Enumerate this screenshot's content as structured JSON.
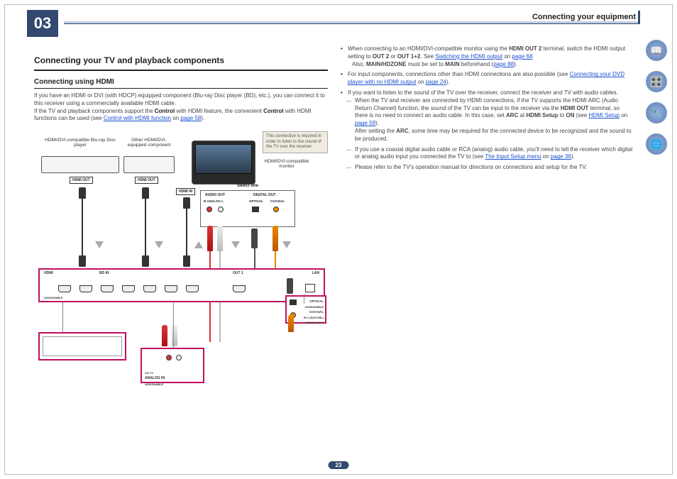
{
  "chapter": "03",
  "header": "Connecting your equipment",
  "page_number": "23",
  "left": {
    "h1": "Connecting your TV and playback components",
    "h2": "Connecting using HDMI",
    "p1a": "If you have an HDMI or DVI (with HDCP) equipped component (Blu-ray Disc player (BD), etc.), you can connect it to this receiver using a commercially available HDMI cable.",
    "p1b_a": "If the TV and playback components support the ",
    "p1b_b": "Control",
    "p1b_c": " with HDMI feature, the convenient ",
    "p1b_d": "Control",
    "p1b_e": " with HDMI functions can be used (see ",
    "link1": "Control with HDMI function",
    "p1b_f": " on ",
    "link1p": "page 58",
    "p1b_g": ")."
  },
  "right": {
    "b1a": "When connecting to an HDMI/DVI-compatible monitor using the ",
    "b1b": "HDMI OUT 2",
    "b1c": " terminal, switch the HDMI output setting to ",
    "b1d": "OUT 2",
    "b1e": " or ",
    "b1f": "OUT 1+2",
    "b1g": ". See ",
    "link_sw": "Switching the HDMI output",
    "b1h": " on ",
    "link_sw_p": "page 68",
    "b1i": ".",
    "b1j": "Also, ",
    "b1k": "MAIN/HDZONE",
    "b1l": " must be set to ",
    "b1m": "MAIN",
    "b1n": " beforehand (",
    "link_main_p": "page 88",
    "b1o": ").",
    "b2a": "For input components, connections other than HDMI connections are also possible (see ",
    "link_dvd": "Connecting your DVD player with no HDMI output",
    "b2b": " on ",
    "link_dvd_p": "page 24",
    "b2c": ").",
    "b3": "If you want to listen to the sound of the TV over the receiver, connect the receiver and TV with audio cables.",
    "d1a": "When the TV and receiver are connected by HDMI connections, if the TV supports the HDMI ARC (Audio Return Channel) function, the sound of the TV can be input to the receiver via the ",
    "d1b": "HDMI OUT",
    "d1c": " terminal, so there is no need to connect an audio cable. In this case, set ",
    "d1d": "ARC",
    "d1e": " at ",
    "d1f": "HDMI Setup",
    "d1g": " to ",
    "d1h": "ON",
    "d1i": " (see ",
    "link_hdmis": "HDMI Setup",
    "d1j": " on ",
    "link_hdmis_p": "page 59",
    "d1k": ").",
    "d1_after_a": "After setting the ",
    "d1_after_b": "ARC",
    "d1_after_c": ", some time may be required for the connected device to be recognized and the sound to be produced.",
    "d2a": "If you use a coaxial digital audio cable or RCA (analog) audio cable, you'll need to tell the receiver which digital or analog audio input you connected the TV to (see ",
    "link_input": "The Input Setup menu",
    "d2b": " on ",
    "link_input_p": "page 36",
    "d2c": ").",
    "d3": "Please refer to the TV's operation manual for directions on connections and setup for the TV."
  },
  "diagram": {
    "lbl_bluray": "HDMI/DVI-compatible Blu-ray Disc player",
    "lbl_other": "Other HDMI/DVI-equipped component",
    "lbl_monitor": "HDMI/DVI-compatible monitor",
    "callout": "This connection is required in order to listen to the sound of the TV over the receiver.",
    "hdmi_out": "HDMI OUT",
    "hdmi_in": "HDMI IN",
    "select_one": "Select one",
    "audio_out": "AUDIO OUT",
    "digital_out": "DIGITAL OUT",
    "analog_rl": "R  ANALOG  L",
    "optical": "OPTICAL",
    "coaxial": "COAXIAL",
    "hdmi": "HDMI",
    "bd_in": "BD IN",
    "out1": "OUT 1",
    "lan": "LAN",
    "assignable": "ASSIGNABLE",
    "analog_in": "ANALOG IN",
    "cd_tv": "CD TV",
    "in1": "IN 1 (SAT/CBL)"
  },
  "side": {
    "book": "📖",
    "setup": "🎛️",
    "qa": "🔧",
    "globe": "🌐"
  }
}
